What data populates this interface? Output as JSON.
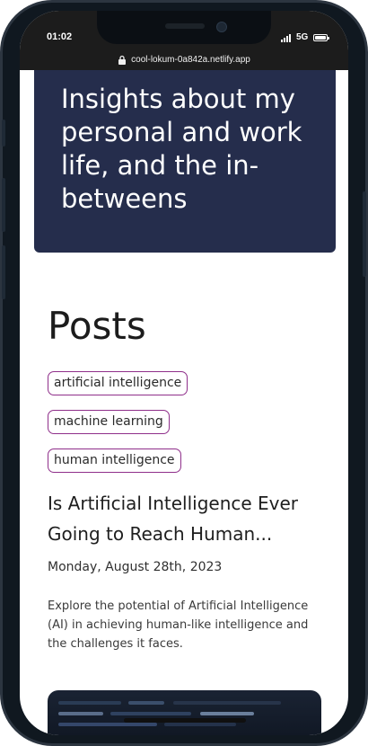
{
  "status_bar": {
    "time": "01:02",
    "network": "5G",
    "url": "cool-lokum-0a842a.netlify.app"
  },
  "hero": {
    "title": "Insights about my personal and work life, and the in-betweens"
  },
  "posts": {
    "heading": "Posts",
    "tags": [
      "artificial intelligence",
      "machine learning",
      "human intelligence"
    ],
    "items": [
      {
        "title": "Is Artificial Intelligence Ever Going to Reach Human...",
        "date": "Monday, August 28th, 2023",
        "excerpt": "Explore the potential of Artificial Intelligence (AI) in achieving human-like intelligence and the challenges it faces."
      }
    ]
  },
  "colors": {
    "hero_bg": "#252d4c",
    "tag_border": "#8f2f8a",
    "status_bg": "#1c1c1c"
  }
}
